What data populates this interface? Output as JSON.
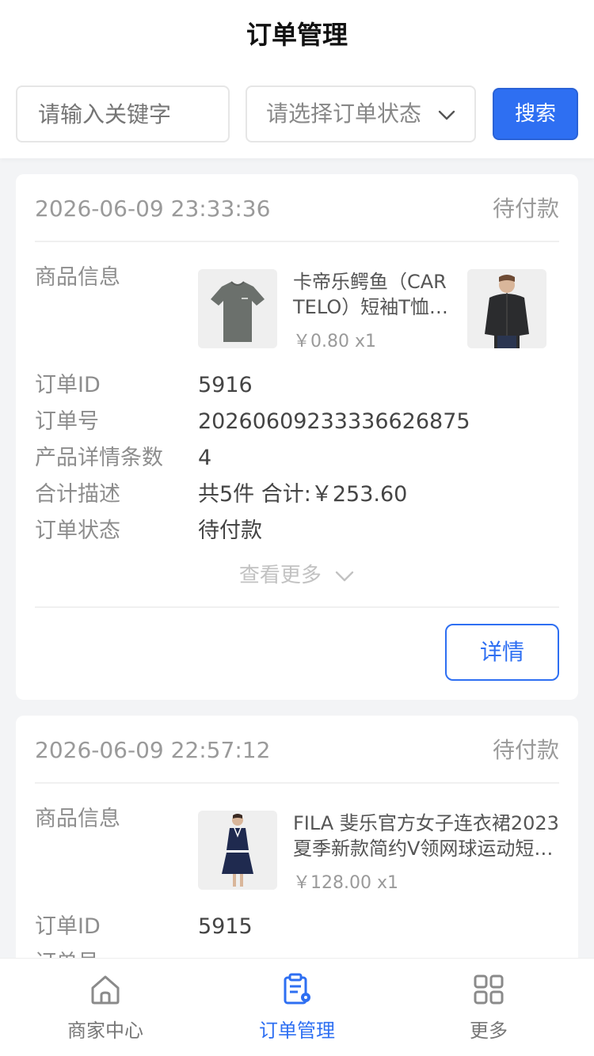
{
  "header": {
    "title": "订单管理",
    "search_placeholder": "请输入关键字",
    "status_select_value": "请选择订单状态",
    "search_button": "搜索"
  },
  "labels": {
    "product_info": "商品信息",
    "order_id": "订单ID",
    "order_no": "订单号",
    "detail_count": "产品详情条数",
    "total_desc": "合计描述",
    "order_status": "订单状态",
    "view_more": "查看更多",
    "details_button": "详情"
  },
  "orders": [
    {
      "time": "2026-06-09 23:33:36",
      "status": "待付款",
      "product_name": "卡帝乐鳄鱼（CARTELO）短袖T恤…",
      "product_name_line1": "卡帝乐鳄鱼（CAR",
      "product_name_line2": "TELO）短袖T恤…",
      "product_price": "￥0.80 x1",
      "order_id": "5916",
      "order_no": "20260609233336626875",
      "detail_count": "4",
      "total_desc": "共5件 合计:￥253.60",
      "order_status": "待付款"
    },
    {
      "time": "2026-06-09 22:57:12",
      "status": "待付款",
      "product_name_line1": "FILA 斐乐官方女子连衣裙2023",
      "product_name_line2": "夏季新款简约V领网球运动短…",
      "product_price": "￥128.00 x1",
      "order_id": "5915"
    }
  ],
  "tabbar": {
    "items": [
      {
        "label": "商家中心",
        "icon": "home-icon"
      },
      {
        "label": "订单管理",
        "icon": "order-list-icon"
      },
      {
        "label": "更多",
        "icon": "grid-icon"
      }
    ],
    "active_color": "#2e6ff2"
  },
  "colors": {
    "accent": "#2e6ff2",
    "background": "#f3f4f6"
  }
}
